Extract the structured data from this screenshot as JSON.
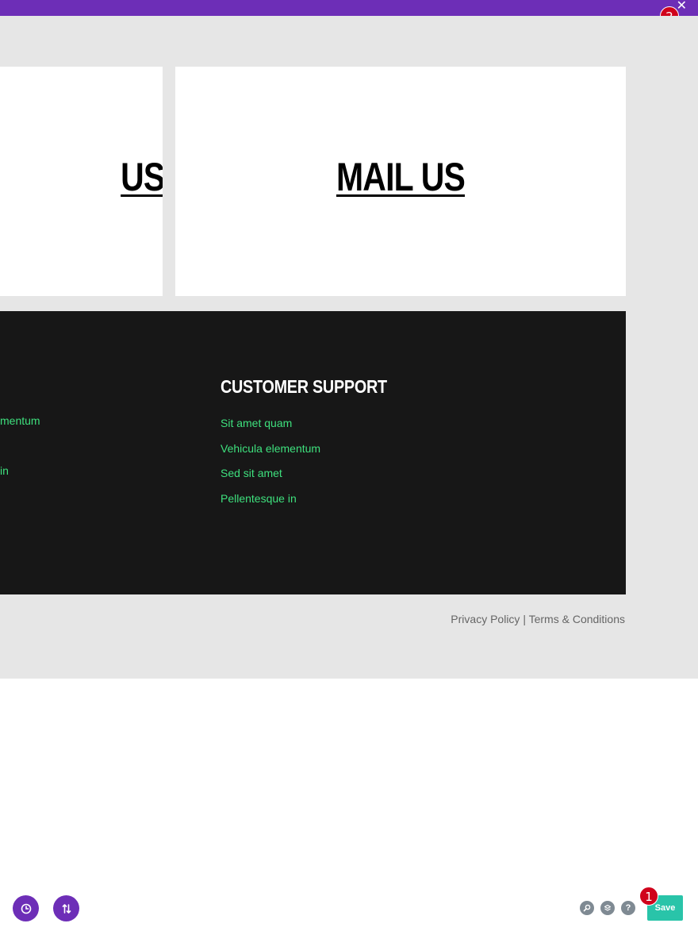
{
  "top_bar": {
    "color": "#6d2eb7",
    "close_icon": "close-icon",
    "close_glyph": "✕"
  },
  "markers": {
    "first": "1",
    "second": "2"
  },
  "cards": {
    "left_title_partial": "US",
    "right_title": "MAIL US"
  },
  "footer": {
    "left_column_partial_links": [
      "mentum",
      "in"
    ],
    "heading": "CUSTOMER SUPPORT",
    "links": [
      "Sit amet quam",
      "Vehicula elementum",
      "Sed sit amet",
      "Pellentesque in"
    ],
    "link_color": "#3ee07d"
  },
  "legal": {
    "privacy": "Privacy Policy",
    "separator": "|",
    "terms": "Terms & Conditions"
  },
  "builder_controls": {
    "history_icon": "clock-icon",
    "portability_icon": "sort-arrows-icon",
    "zoom_icon": "search-icon",
    "layers_icon": "layers-icon",
    "help_icon": "help-icon",
    "help_glyph": "?",
    "save_label": "Save",
    "save_color": "#29c4a9"
  }
}
